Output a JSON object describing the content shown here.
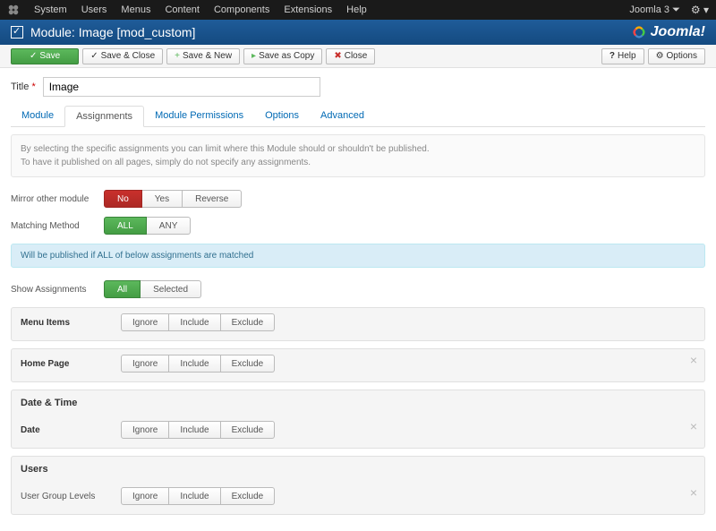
{
  "topmenu": {
    "items": [
      "System",
      "Users",
      "Menus",
      "Content",
      "Components",
      "Extensions",
      "Help"
    ],
    "version": "Joomla 3 ⏷"
  },
  "titlebar": {
    "title": "Module: Image [mod_custom]",
    "brand": "Joomla!"
  },
  "toolbar": {
    "save": "Save",
    "saveclose": "Save & Close",
    "savenew": "Save & New",
    "savecopy": "Save as Copy",
    "close": "Close",
    "help": "Help",
    "options": "Options"
  },
  "form": {
    "title_label": "Title",
    "req": "*",
    "title_value": "Image",
    "tabs": [
      "Module",
      "Assignments",
      "Module Permissions",
      "Options",
      "Advanced"
    ],
    "info_line1": "By selecting the specific assignments you can limit where this Module should or shouldn't be published.",
    "info_line2": "To have it published on all pages, simply do not specify any assignments.",
    "mirror_label": "Mirror other module",
    "mirror_opts": {
      "no": "No",
      "yes": "Yes",
      "reverse": "Reverse"
    },
    "match_label": "Matching Method",
    "match_opts": {
      "all": "ALL",
      "any": "ANY"
    },
    "blue_note": "Will be published if ALL of below assignments are matched",
    "show_label": "Show Assignments",
    "show_opts": {
      "all": "All",
      "selected": "Selected"
    },
    "iie": {
      "ignore": "Ignore",
      "include": "Include",
      "exclude": "Exclude"
    },
    "panels": {
      "menu": "Menu Items",
      "home": "Home Page",
      "datetime": "Date & Time",
      "date_label": "Date",
      "users": "Users",
      "ugl_label": "User Group Levels"
    }
  }
}
